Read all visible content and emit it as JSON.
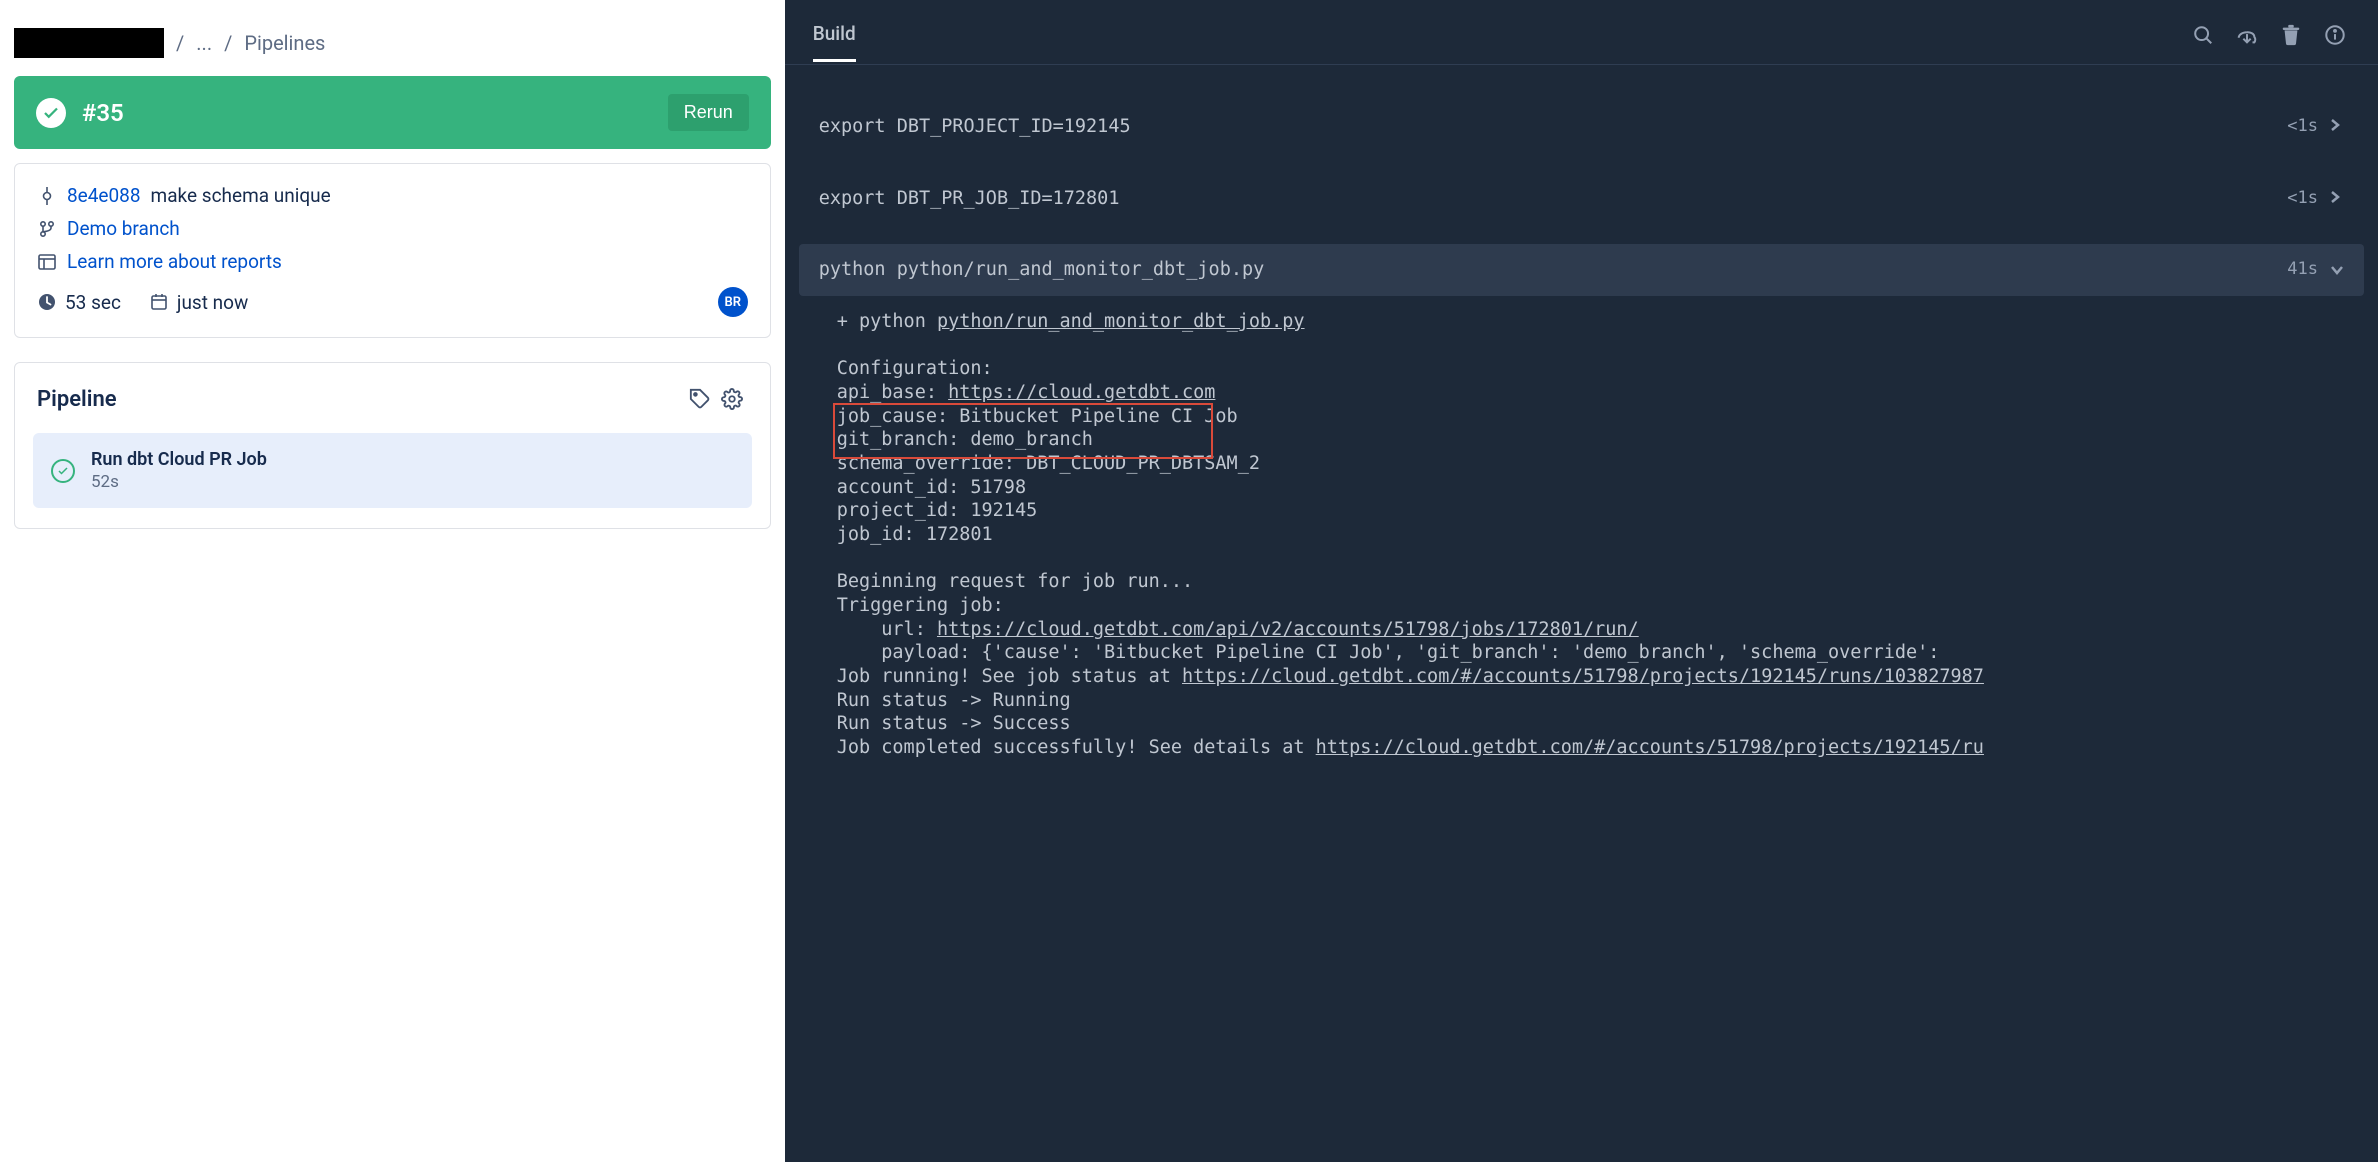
{
  "breadcrumb": {
    "ellipsis": "...",
    "current": "Pipelines"
  },
  "run": {
    "number": "#35",
    "rerun": "Rerun"
  },
  "commit": {
    "hash": "8e4e088",
    "message": "make schema unique",
    "branch": "Demo branch",
    "reports_link": "Learn more about reports",
    "duration": "53 sec",
    "time": "just now",
    "avatar": "BR"
  },
  "pipeline": {
    "title": "Pipeline",
    "step": {
      "name": "Run dbt Cloud PR Job",
      "duration": "52s"
    }
  },
  "rightTab": "Build",
  "logs": {
    "row1": {
      "cmd": "export DBT_PROJECT_ID=192145",
      "dur": "<1s"
    },
    "row2": {
      "cmd": "export DBT_PR_JOB_ID=172801",
      "dur": "<1s"
    },
    "row3": {
      "cmd": "python python/run_and_monitor_dbt_job.py",
      "dur": "41s"
    },
    "output": {
      "l1a": "+ python ",
      "l1b": "python/run_and_monitor_dbt_job.py",
      "l2": "Configuration:",
      "l3a": "api_base: ",
      "l3b": "https://cloud.getdbt.com",
      "l4": "job_cause: Bitbucket Pipeline CI Job",
      "l5": "git_branch: demo_branch",
      "l6": "schema_override: DBT_CLOUD_PR_DBTSAM_2",
      "l7": "account_id: 51798",
      "l8": "project_id: 192145",
      "l9": "job_id: 172801",
      "l10": "Beginning request for job run...",
      "l11": "Triggering job:",
      "l12a": "    url: ",
      "l12b": "https://cloud.getdbt.com/api/v2/accounts/51798/jobs/172801/run/",
      "l13": "    payload: {'cause': 'Bitbucket Pipeline CI Job', 'git_branch': 'demo_branch', 'schema_override':",
      "l14a": "Job running! See job status at ",
      "l14b": "https://cloud.getdbt.com/#/accounts/51798/projects/192145/runs/103827987",
      "l15": "Run status -> Running",
      "l16": "Run status -> Success",
      "l17a": "Job completed successfully! See details at ",
      "l17b": "https://cloud.getdbt.com/#/accounts/51798/projects/192145/ru"
    }
  }
}
